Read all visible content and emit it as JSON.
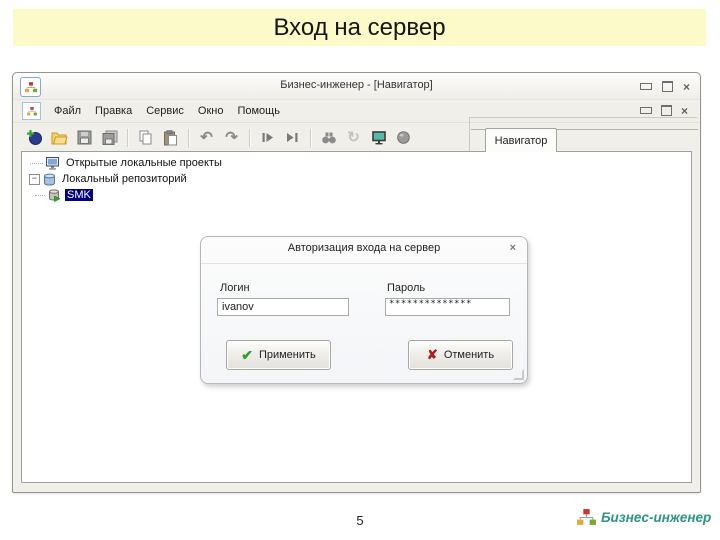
{
  "slide": {
    "title": "Вход на сервер",
    "page_number": "5"
  },
  "window": {
    "title": "Бизнес-инженер - [Навигатор]",
    "menu_items": [
      {
        "label": "Файл"
      },
      {
        "label": "Правка"
      },
      {
        "label": "Сервис"
      },
      {
        "label": "Окно"
      },
      {
        "label": "Помощь"
      }
    ],
    "toolbar_icons": [
      "new-project-icon",
      "open-folder-icon",
      "save-icon",
      "save-all-icon",
      "copy-icon",
      "paste-icon",
      "undo-icon",
      "redo-icon",
      "import-icon",
      "export-icon",
      "find-icon",
      "refresh-icon",
      "monitor-icon",
      "sphere-icon"
    ],
    "navigator_tab": "Навигатор",
    "tree": {
      "items": [
        {
          "label": "Открытые локальные проекты",
          "icon": "computer-icon",
          "selected": false
        },
        {
          "label": "Локальный репозиторий",
          "icon": "database-icon",
          "selected": false
        },
        {
          "label": "SMK",
          "icon": "database-run-icon",
          "selected": true
        }
      ]
    }
  },
  "dialog": {
    "title": "Авторизация входа на сервер",
    "login_label": "Логин",
    "password_label": "Пароль",
    "login_value": "ivanov",
    "password_value": "**************",
    "apply_label": "Применить",
    "cancel_label": "Отменить"
  },
  "icons": {
    "apply_check": "✔",
    "cancel_x": "✘",
    "close_x": "×",
    "undo": "↶",
    "redo": "↷",
    "refresh": "↻",
    "expander_minus": "−"
  },
  "footer": {
    "logo_text": "Бизнес-инженер"
  },
  "colors": {
    "banner_bg": "#FBFAC8",
    "window_chrome": "#F1EFEA",
    "tree_selection": "#000080",
    "apply_check": "#2EA12E",
    "cancel_x": "#A82020",
    "logo_text": "#2E9484",
    "logo_red": "#C8372F",
    "logo_yellow": "#E2A93B",
    "logo_green": "#76A92F"
  }
}
